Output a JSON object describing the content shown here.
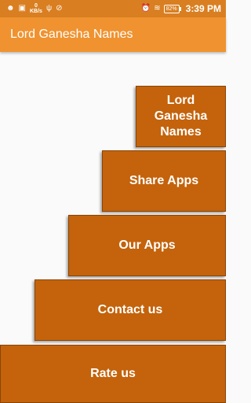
{
  "status_bar": {
    "data_rate_value": "0",
    "data_rate_unit": "KB/s",
    "battery": "82%",
    "time": "3:39 PM"
  },
  "app_bar": {
    "title": "Lord Ganesha Names"
  },
  "menu": {
    "names_label": "Lord\nGanesha\nNames",
    "share_label": "Share Apps",
    "our_apps_label": "Our Apps",
    "contact_label": "Contact us",
    "rate_label": "Rate us"
  },
  "colors": {
    "status_bar": "#d97f21",
    "app_bar": "#f0922f",
    "button": "#c4630b",
    "background": "#fafafa"
  }
}
